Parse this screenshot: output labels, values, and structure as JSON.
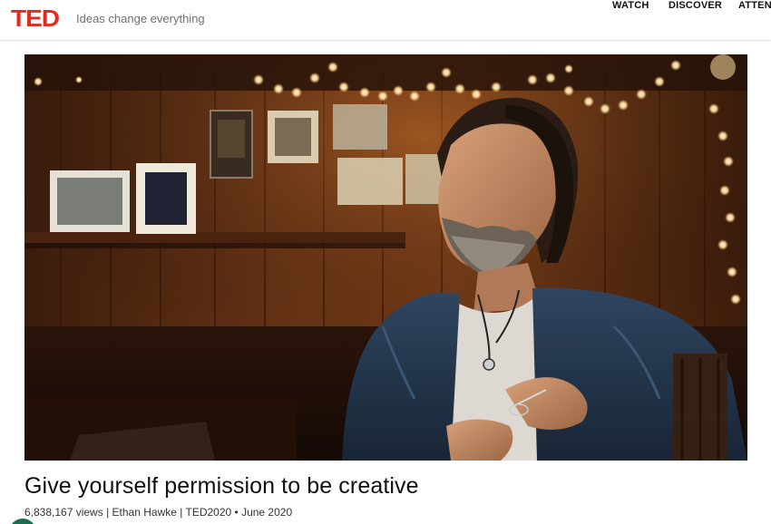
{
  "header": {
    "logo_text": "TED",
    "tagline": "Ideas change everything",
    "nav": [
      "WATCH",
      "DISCOVER",
      "ATTEN"
    ]
  },
  "hero": {
    "icon": "speaker-portrait-image"
  },
  "talk": {
    "title": "Give yourself permission to be creative",
    "views": "6,838,167 views",
    "speaker": "Ethan Hawke",
    "event": "TED2020",
    "date": "June 2020",
    "sep_pipe": " | ",
    "sep_bullet": " • "
  },
  "colors": {
    "brand_red": "#e62b1e",
    "text": "#111111",
    "muted": "#707070"
  }
}
